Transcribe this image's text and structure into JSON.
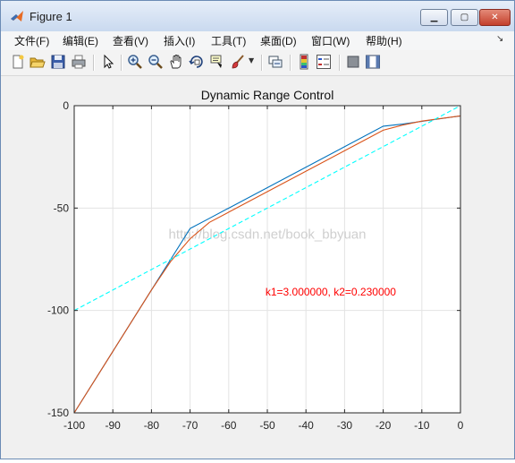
{
  "window": {
    "title": "Figure 1"
  },
  "menu": [
    {
      "label": "文件(F)"
    },
    {
      "label": "编辑(E)"
    },
    {
      "label": "查看(V)"
    },
    {
      "label": "插入(I)"
    },
    {
      "label": "工具(T)"
    },
    {
      "label": "桌面(D)"
    },
    {
      "label": "窗口(W)"
    },
    {
      "label": "帮助(H)"
    }
  ],
  "toolbar": [
    {
      "icon": "new-figure-icon"
    },
    {
      "icon": "open-file-icon"
    },
    {
      "icon": "save-icon"
    },
    {
      "icon": "print-icon"
    },
    {
      "icon": "pointer-icon"
    },
    {
      "icon": "zoom-in-icon"
    },
    {
      "icon": "zoom-out-icon"
    },
    {
      "icon": "pan-hand-icon"
    },
    {
      "icon": "rotate-3d-icon"
    },
    {
      "icon": "data-cursor-icon"
    },
    {
      "icon": "brush-icon"
    },
    {
      "icon": "link-plot-icon"
    },
    {
      "icon": "colorbar-icon"
    },
    {
      "icon": "legend-icon"
    },
    {
      "icon": "hide-plot-tools-icon"
    },
    {
      "icon": "show-plot-tools-icon"
    }
  ],
  "chart_data": {
    "type": "line",
    "title": "Dynamic Range Control",
    "xlabel": "",
    "ylabel": "",
    "xlim": [
      -100,
      0
    ],
    "ylim": [
      -150,
      0
    ],
    "xticks": [
      -100,
      -90,
      -80,
      -70,
      -60,
      -50,
      -40,
      -30,
      -20,
      -10,
      0
    ],
    "yticks": [
      -150,
      -100,
      -50,
      0
    ],
    "grid": true,
    "annotation": "k1=3.000000, k2=0.230000",
    "watermark": "http://blog.csdn.net/book_bbyuan",
    "colors": {
      "blue": "#0072bd",
      "orange": "#d95319",
      "cyan": "#00ffff",
      "annotation": "#ff0000"
    },
    "series": [
      {
        "color": "#0072bd",
        "x": [
          -100,
          -80,
          -75,
          -70,
          -65,
          -20,
          -15,
          0
        ],
        "y": [
          -150,
          -90,
          -75,
          -60,
          -55,
          -10,
          -9,
          -5
        ]
      },
      {
        "color": "#d95319",
        "x": [
          -100,
          -80,
          -75,
          -70,
          -65,
          -60,
          -25,
          -20,
          -15,
          -10,
          0
        ],
        "y": [
          -150,
          -90,
          -76,
          -65,
          -57,
          -52,
          -17,
          -12,
          -9.5,
          -7.5,
          -5
        ]
      },
      {
        "color": "#00ffff",
        "dashed": true,
        "x": [
          -100,
          0
        ],
        "y": [
          -100,
          0
        ]
      }
    ]
  }
}
